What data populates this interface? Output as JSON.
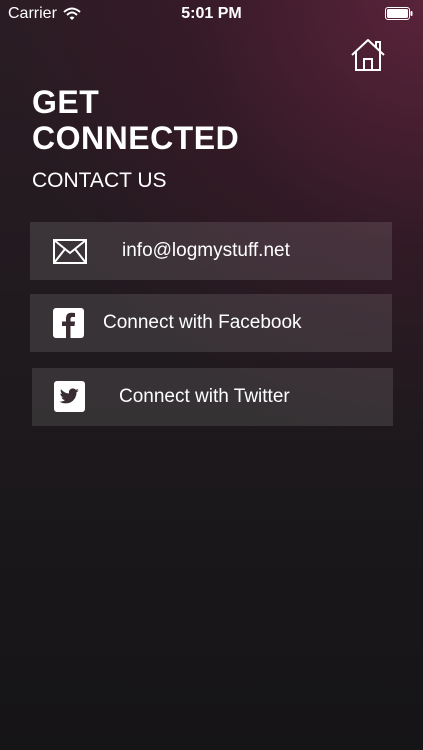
{
  "status_bar": {
    "carrier": "Carrier",
    "time": "5:01 PM",
    "wifi_icon": "wifi-icon",
    "battery_icon": "battery-full-icon"
  },
  "header": {
    "home_icon": "home-icon",
    "title_line1": "GET",
    "title_line2": "CONNECTED",
    "subtitle": "CONTACT US"
  },
  "contacts": {
    "email": {
      "label": "info@logmystuff.net",
      "icon": "envelope-icon"
    },
    "facebook": {
      "label": "Connect with Facebook",
      "icon": "facebook-icon"
    },
    "twitter": {
      "label": "Connect with Twitter",
      "icon": "twitter-icon"
    }
  },
  "colors": {
    "accent": "#6e2644",
    "background": "#1f1a1e",
    "button_fill": "#3a2c33",
    "text": "#ffffff"
  }
}
